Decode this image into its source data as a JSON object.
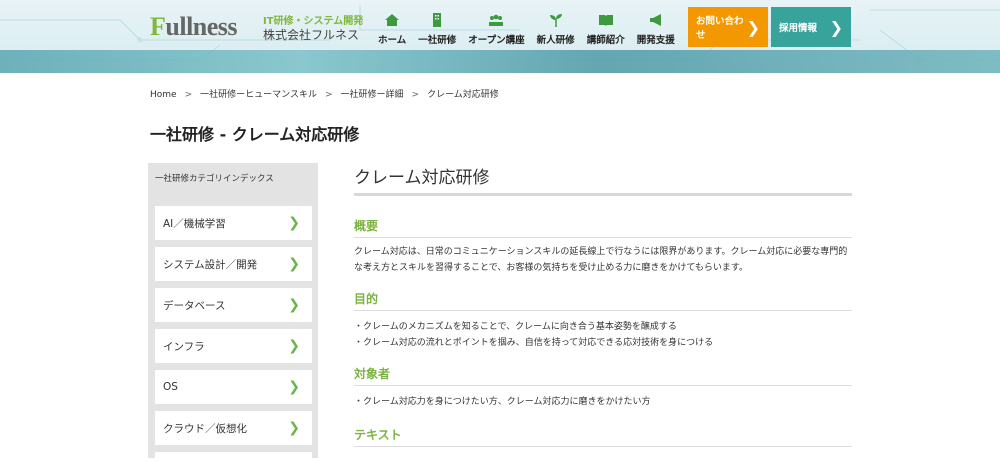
{
  "header": {
    "logo_first": "F",
    "logo_rest": "ullness",
    "logo_sub": "IT研修・システム開発",
    "company": "株式会社フルネス",
    "nav": [
      {
        "label": "ホーム",
        "icon": "home-icon"
      },
      {
        "label": "一社研修",
        "icon": "building-icon"
      },
      {
        "label": "オープン講座",
        "icon": "people-icon"
      },
      {
        "label": "新人研修",
        "icon": "sprout-icon"
      },
      {
        "label": "講師紹介",
        "icon": "book-icon"
      },
      {
        "label": "開発支援",
        "icon": "megaphone-icon"
      }
    ],
    "contact": "お問い合わせ",
    "recruit": "採用情報",
    "colors": {
      "contact": "#f39800",
      "recruit": "#38a39a",
      "accent": "#7cb342"
    }
  },
  "breadcrumb": [
    "Home",
    "一社研修ーヒューマンスキル",
    "一社研修ー詳細",
    "クレーム対応研修"
  ],
  "page_title": "一社研修 - クレーム対応研修",
  "sidebar": {
    "heading": "一社研修カテゴリインデックス",
    "items": [
      "AI／機械学習",
      "システム設計／開発",
      "データベース",
      "インフラ",
      "OS",
      "クラウド／仮想化"
    ]
  },
  "main": {
    "title": "クレーム対応研修",
    "sections": [
      {
        "heading": "概要",
        "lines": [
          "クレーム対応は、日常のコミュニケーションスキルの延長線上で行なうには限界があります。クレーム対応に必要な専門的な考え方とスキルを習得することで、お客様の気持ちを受け止める力に磨きをかけてもらいます。"
        ]
      },
      {
        "heading": "目的",
        "lines": [
          "・クレームのメカニズムを知ることで、クレームに向き合う基本姿勢を醸成する",
          "・クレーム対応の流れとポイントを掴み、自信を持って対応できる応対技術を身につける"
        ]
      },
      {
        "heading": "対象者",
        "lines": [
          "・クレーム対応力を身につけたい方、クレーム対応力に磨きをかけたい方"
        ]
      },
      {
        "heading": "テキスト",
        "lines": []
      }
    ]
  }
}
